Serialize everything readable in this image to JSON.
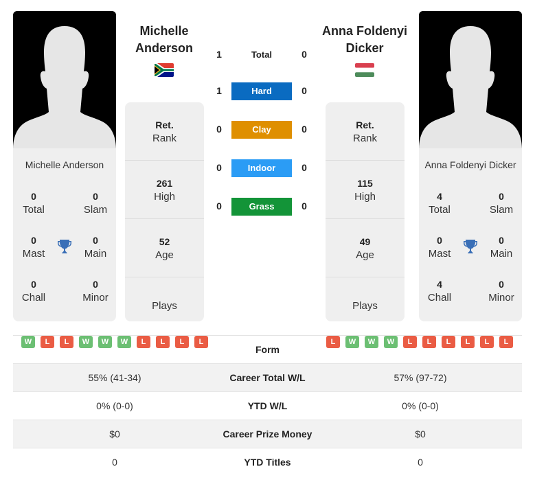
{
  "colors": {
    "hard": "#0a6bc1",
    "clay": "#df8f00",
    "indoor": "#2b9cf5",
    "grass": "#139438",
    "win": "#6cbf73",
    "loss": "#ea5c44",
    "trophy": "#3a6fb7"
  },
  "players": {
    "left": {
      "name": "Michelle Anderson",
      "name_line1": "Michelle",
      "name_line2": "Anderson",
      "flag": "south-africa",
      "photo": "silhouette-placeholder",
      "titles": {
        "total": "0",
        "total_label": "Total",
        "slam": "0",
        "slam_label": "Slam",
        "mast": "0",
        "mast_label": "Mast",
        "main": "0",
        "main_label": "Main",
        "chall": "0",
        "chall_label": "Chall",
        "minor": "0",
        "minor_label": "Minor"
      },
      "rank": {
        "value": "Ret.",
        "label": "Rank"
      },
      "high": {
        "value": "261",
        "label": "High"
      },
      "age": {
        "value": "52",
        "label": "Age"
      },
      "plays": {
        "label": "Plays"
      },
      "form": [
        "W",
        "L",
        "L",
        "W",
        "W",
        "W",
        "L",
        "L",
        "L",
        "L"
      ]
    },
    "right": {
      "name": "Anna Foldenyi Dicker",
      "name_line1": "Anna Foldenyi",
      "name_line2": "Dicker",
      "flag": "hungary",
      "photo": "silhouette-placeholder",
      "titles": {
        "total": "4",
        "total_label": "Total",
        "slam": "0",
        "slam_label": "Slam",
        "mast": "0",
        "mast_label": "Mast",
        "main": "0",
        "main_label": "Main",
        "chall": "4",
        "chall_label": "Chall",
        "minor": "0",
        "minor_label": "Minor"
      },
      "rank": {
        "value": "Ret.",
        "label": "Rank"
      },
      "high": {
        "value": "115",
        "label": "High"
      },
      "age": {
        "value": "49",
        "label": "Age"
      },
      "plays": {
        "label": "Plays"
      },
      "form": [
        "L",
        "W",
        "W",
        "W",
        "L",
        "L",
        "L",
        "L",
        "L",
        "L"
      ]
    }
  },
  "h2h": [
    {
      "label": "Total",
      "left": "1",
      "right": "0",
      "surface": "total"
    },
    {
      "label": "Hard",
      "left": "1",
      "right": "0",
      "surface": "hard"
    },
    {
      "label": "Clay",
      "left": "0",
      "right": "0",
      "surface": "clay"
    },
    {
      "label": "Indoor",
      "left": "0",
      "right": "0",
      "surface": "indoor"
    },
    {
      "label": "Grass",
      "left": "0",
      "right": "0",
      "surface": "grass"
    }
  ],
  "stats": [
    {
      "label": "Form",
      "left": "",
      "right": ""
    },
    {
      "label": "Career Total W/L",
      "left": "55% (41-34)",
      "right": "57% (97-72)"
    },
    {
      "label": "YTD W/L",
      "left": "0% (0-0)",
      "right": "0% (0-0)"
    },
    {
      "label": "Career Prize Money",
      "left": "$0",
      "right": "$0"
    },
    {
      "label": "YTD Titles",
      "left": "0",
      "right": "0"
    }
  ]
}
